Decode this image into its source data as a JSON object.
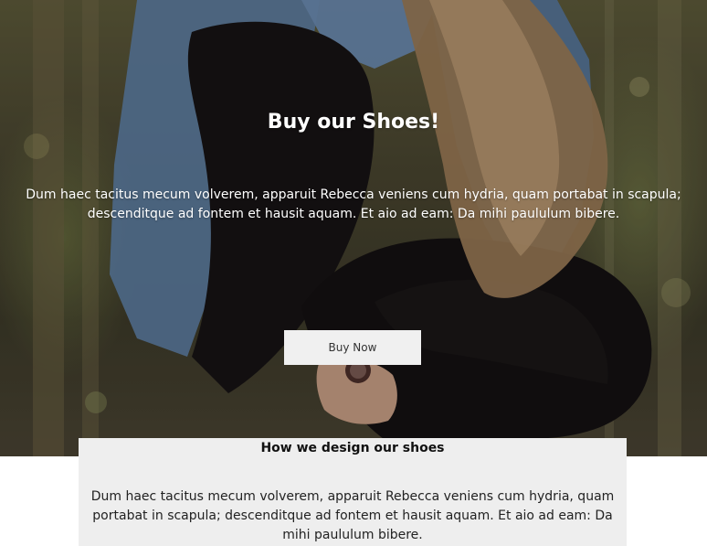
{
  "hero": {
    "title": "Buy our Shoes!",
    "text": "Dum haec tacitus mecum volverem, apparuit Rebecca veniens cum hydria, quam portabat in scapula; descenditque ad fontem et hausit aquam. Et aio ad eam: Da mihi paululum bibere.",
    "button_label": "Buy Now"
  },
  "design": {
    "title": "How we design our shoes",
    "text": "Dum haec tacitus mecum volverem, apparuit Rebecca veniens cum hydria, quam portabat in scapula; descenditque ad fontem et hausit aquam. Et aio ad eam: Da mihi paululum bibere."
  },
  "colors": {
    "hero_overlay_text": "#ffffff",
    "button_background": "#f0f0f0",
    "section_background": "#eeeeee"
  }
}
